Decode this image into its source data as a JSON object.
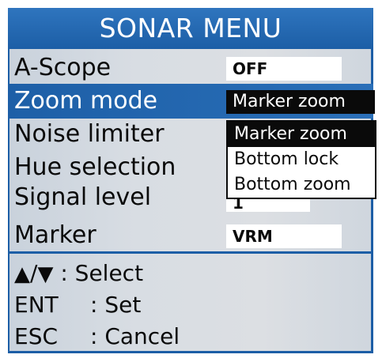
{
  "title": "SONAR MENU",
  "rows": [
    {
      "label": "A-Scope",
      "value": "OFF"
    },
    {
      "label": "Zoom mode",
      "value": "Marker zoom"
    },
    {
      "label": "Noise limiter",
      "value": ""
    },
    {
      "label": "Hue selection",
      "value": ""
    },
    {
      "label": "Signal level",
      "value": "1"
    },
    {
      "label": "Marker",
      "value": "VRM"
    }
  ],
  "selected_row": "Zoom mode",
  "dropdown": {
    "options": [
      "Marker zoom",
      "Bottom lock",
      "Bottom zoom"
    ],
    "highlighted": "Marker zoom"
  },
  "help": {
    "up_arrow": "▲",
    "slash": "/",
    "down_arrow": "▼",
    "select_text": ": Select",
    "ent_key": "ENT",
    "ent_text": ": Set",
    "esc_key": "ESC",
    "esc_text": ": Cancel"
  },
  "colors": {
    "title_bar": "#1c5ea6",
    "selection": "#1d5fa7",
    "panel": "#d8dde3"
  }
}
